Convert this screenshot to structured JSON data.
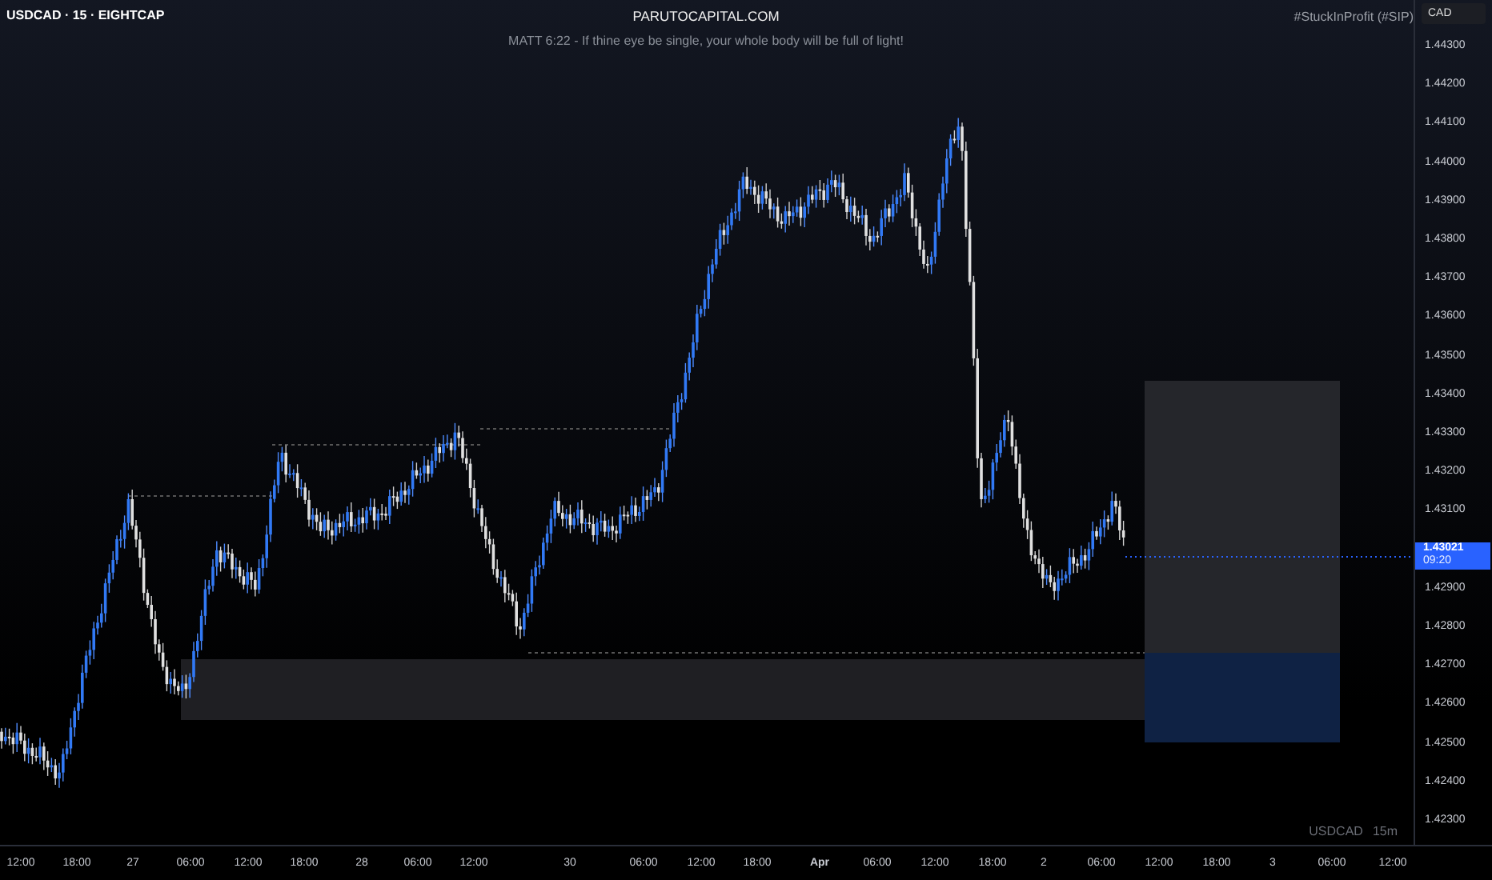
{
  "header": {
    "symbol": "USDCAD · 15 · EIGHTCAP",
    "site": "PARUTOCAPITAL.COM",
    "caption": "MATT 6:22 - If thine eye be single, your whole body will be full of light!",
    "tag": "#StuckInProfit (#SIP)"
  },
  "price_axis": {
    "currency": "CAD",
    "ticks": [
      "1.44300",
      "1.44200",
      "1.44100",
      "1.44000",
      "1.43900",
      "1.43800",
      "1.43700",
      "1.43600",
      "1.43500",
      "1.43400",
      "1.43300",
      "1.43200",
      "1.43100",
      "1.42900",
      "1.42800",
      "1.42700",
      "1.42600",
      "1.42500",
      "1.42400",
      "1.42300"
    ],
    "current": {
      "price": "1.43021",
      "countdown": "09:20"
    }
  },
  "legend": {
    "symbol": "USDCAD",
    "interval": "15m"
  },
  "time_axis": [
    {
      "label": "12:00",
      "kind": "time"
    },
    {
      "label": "18:00",
      "kind": "time"
    },
    {
      "label": "27",
      "kind": "day"
    },
    {
      "label": "06:00",
      "kind": "time"
    },
    {
      "label": "12:00",
      "kind": "time"
    },
    {
      "label": "18:00",
      "kind": "time"
    },
    {
      "label": "28",
      "kind": "day"
    },
    {
      "label": "06:00",
      "kind": "time"
    },
    {
      "label": "12:00",
      "kind": "time"
    },
    {
      "label": "30",
      "kind": "day"
    },
    {
      "label": "06:00",
      "kind": "time"
    },
    {
      "label": "12:00",
      "kind": "time"
    },
    {
      "label": "18:00",
      "kind": "time"
    },
    {
      "label": "Apr",
      "kind": "month"
    },
    {
      "label": "06:00",
      "kind": "time"
    },
    {
      "label": "12:00",
      "kind": "time"
    },
    {
      "label": "18:00",
      "kind": "time"
    },
    {
      "label": "2",
      "kind": "day"
    },
    {
      "label": "06:00",
      "kind": "time"
    },
    {
      "label": "12:00",
      "kind": "time"
    },
    {
      "label": "18:00",
      "kind": "time"
    },
    {
      "label": "3",
      "kind": "day"
    },
    {
      "label": "06:00",
      "kind": "time"
    },
    {
      "label": "12:00",
      "kind": "time"
    }
  ]
}
